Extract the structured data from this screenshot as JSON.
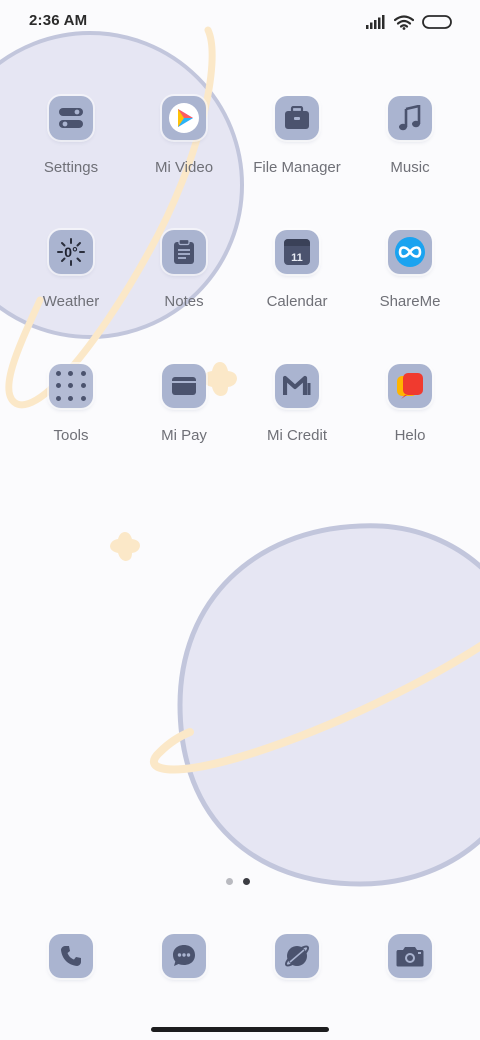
{
  "status_bar": {
    "time": "2:36 AM"
  },
  "apps": [
    {
      "label": "Settings",
      "icon": "settings-toggle-icon"
    },
    {
      "label": "Mi Video",
      "icon": "mi-video-play-icon"
    },
    {
      "label": "File Manager",
      "icon": "briefcase-icon"
    },
    {
      "label": "Music",
      "icon": "music-note-icon"
    },
    {
      "label": "Weather",
      "icon": "weather-sun-icon",
      "badge": "0°"
    },
    {
      "label": "Notes",
      "icon": "notepad-icon"
    },
    {
      "label": "Calendar",
      "icon": "calendar-icon",
      "badge": "11"
    },
    {
      "label": "ShareMe",
      "icon": "shareme-infinity-icon"
    },
    {
      "label": "Tools",
      "icon": "folder-icon"
    },
    {
      "label": "Mi Pay",
      "icon": "wallet-icon"
    },
    {
      "label": "Mi Credit",
      "icon": "mi-credit-icon"
    },
    {
      "label": "Helo",
      "icon": "helo-icon"
    }
  ],
  "page_indicator": {
    "pages": 2,
    "current": 2
  },
  "dock": [
    {
      "icon": "phone-icon"
    },
    {
      "icon": "message-icon"
    },
    {
      "icon": "browser-planet-icon"
    },
    {
      "icon": "camera-icon"
    }
  ],
  "theme": {
    "icon_background": "#aab4d0",
    "icon_glyph": "#4b536e",
    "planet_fill": "#e6e6f3",
    "planet_outline": "#c2c6dc",
    "ring_color": "#fbe8c8",
    "label_color": "#6f7077"
  }
}
